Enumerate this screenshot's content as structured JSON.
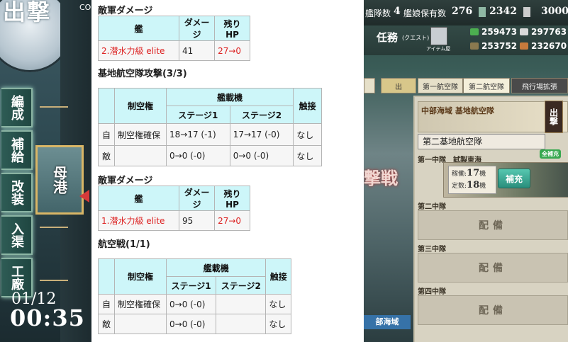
{
  "left": {
    "emblem_text": "出撃",
    "co_fragment": "CO",
    "menu": [
      "編成",
      "補給",
      "改装",
      "入渠",
      "工廠"
    ],
    "port_button": "母港",
    "date": "01/12",
    "time": "00:35"
  },
  "wiki": {
    "damage1": {
      "heading": "敵軍ダメージ",
      "headers": [
        "艦",
        "ダメージ",
        "残りHP"
      ],
      "ship": "2.潜水力級 elite",
      "damage": "41",
      "hp": "27→0"
    },
    "base_attack": {
      "heading": "基地航空隊攻撃(3/3)",
      "h_air": "制空権",
      "h_aircraft": "艦載機",
      "h_stage1": "ステージ1",
      "h_stage2": "ステージ2",
      "h_contact": "触接",
      "rows": [
        {
          "side": "自",
          "air": "制空権確保",
          "s1": "18→17 (-1)",
          "s2": "17→17 (-0)",
          "contact": "なし"
        },
        {
          "side": "敵",
          "air": "",
          "s1": "0→0 (-0)",
          "s2": "0→0 (-0)",
          "contact": "なし"
        }
      ]
    },
    "damage2": {
      "heading": "敵軍ダメージ",
      "headers": [
        "艦",
        "ダメージ",
        "残りHP"
      ],
      "ship": "1.潜水力級 elite",
      "damage": "95",
      "hp": "27→0"
    },
    "air_battle": {
      "heading": "航空戦(1/1)",
      "h_air": "制空権",
      "h_aircraft": "艦載機",
      "h_stage1": "ステージ1",
      "h_stage2": "ステージ2",
      "h_contact": "触接",
      "rows": [
        {
          "side": "自",
          "air": "制空権確保",
          "s1": "0→0 (-0)",
          "s2": "",
          "contact": "なし"
        },
        {
          "side": "敵",
          "air": "",
          "s1": "0→0 (-0)",
          "s2": "",
          "contact": "なし"
        }
      ]
    }
  },
  "right": {
    "topbar": {
      "fleet_label": "艦隊数",
      "fleet_count": "4",
      "shipgirl_label": "艦娘保有数",
      "shipgirl_count": "276",
      "bucket": "2342",
      "coins": "3000"
    },
    "quest_label": "任務",
    "quest_sub": "(クエスト)",
    "item_shop": "アイテム屋",
    "resources": {
      "fuel": "259473",
      "steel": "297763",
      "ammo": "253752",
      "bauxite": "232670"
    },
    "tabs": {
      "sortie": "出",
      "base1": "第一航空隊",
      "base2": "第二航空隊",
      "expand": "飛行場拡張"
    },
    "base_header": "中部海域 基地航空隊",
    "sortie_stamp": "出撃",
    "base_name": "第二基地航空隊",
    "squad1_label": "第一中隊　試製東海",
    "full_resupply": "全補充",
    "sq1_stock_label": "稼働:",
    "sq1_stock": "17",
    "sq1_total_label": "定数:",
    "sq1_total": "18",
    "sq1_unit": "機",
    "resupply": "補充",
    "squad2_label": "第二中隊",
    "squad3_label": "第三中隊",
    "squad4_label": "第四中隊",
    "deploy": "配備",
    "battle_banner": "撃戦",
    "area_label": "部海域",
    "colors": {
      "accent_cyan": "#cdf6f9",
      "damage_red": "#dd2222",
      "resupply_teal": "#2a8e7c"
    }
  }
}
